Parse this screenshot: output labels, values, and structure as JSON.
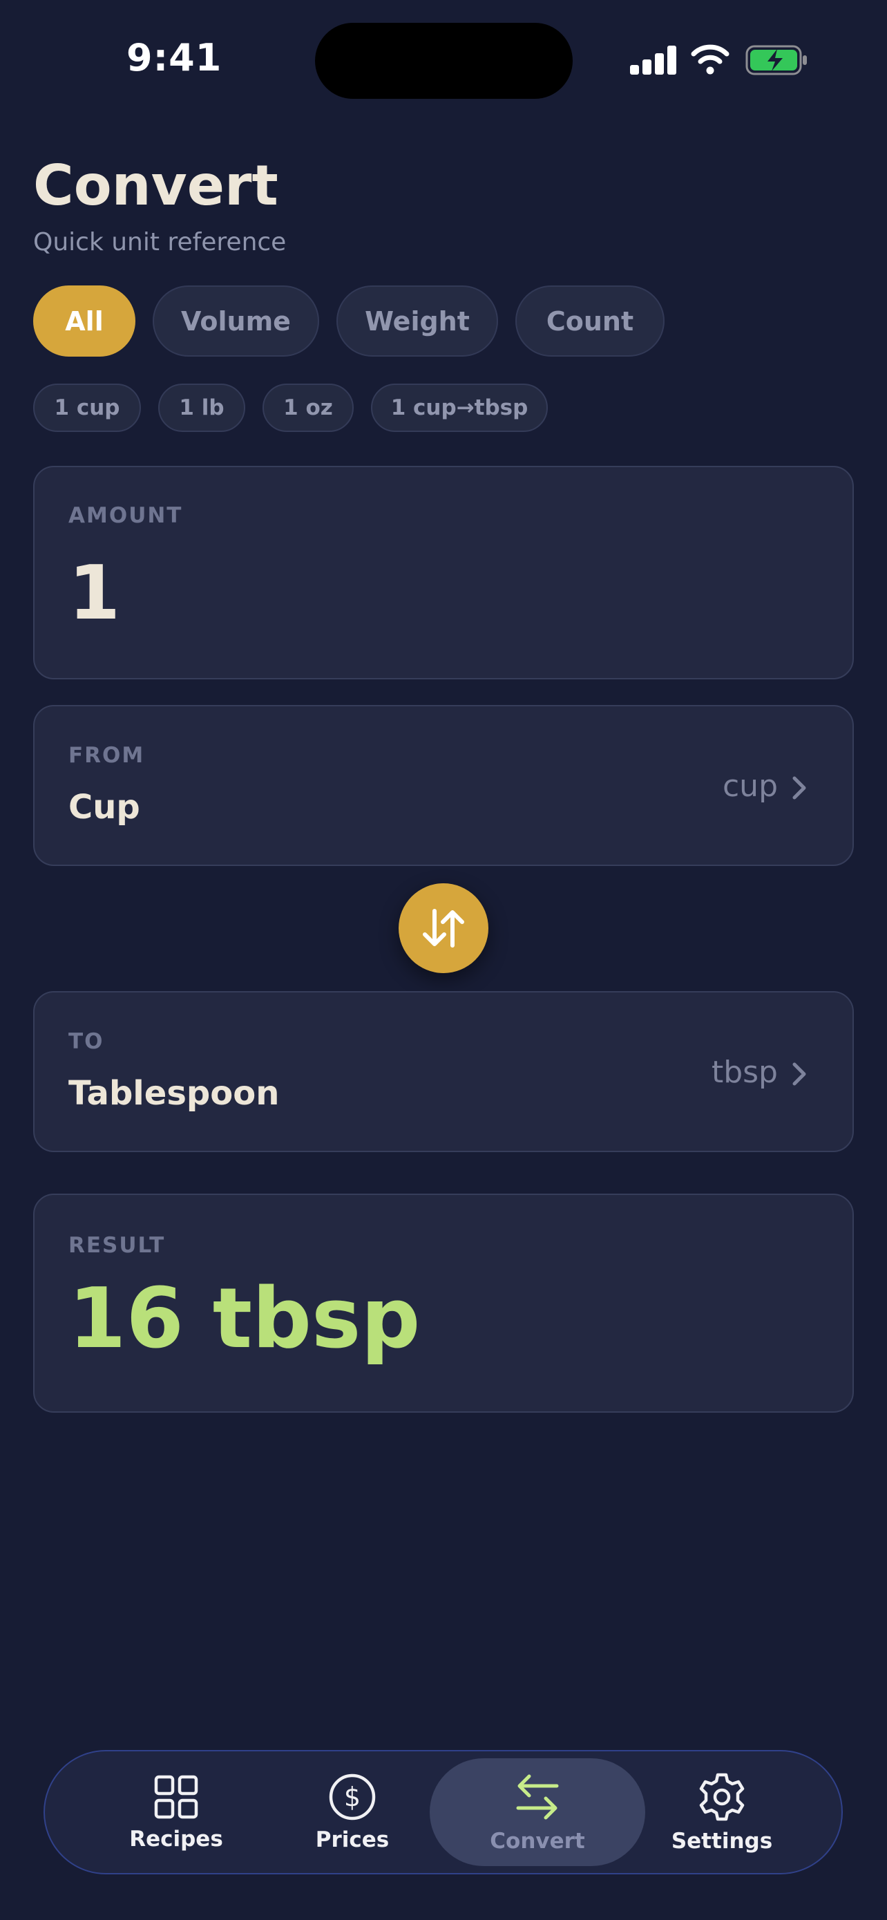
{
  "status": {
    "time": "9:41"
  },
  "header": {
    "title": "Convert",
    "subtitle": "Quick unit reference"
  },
  "filters": [
    {
      "label": "All",
      "active": true
    },
    {
      "label": "Volume",
      "active": false
    },
    {
      "label": "Weight",
      "active": false
    },
    {
      "label": "Count",
      "active": false
    }
  ],
  "quick": [
    "1 cup",
    "1 lb",
    "1 oz",
    "1 cup→tbsp"
  ],
  "amount": {
    "label": "AMOUNT",
    "value": "1"
  },
  "from": {
    "label": "FROM",
    "unit": "Cup",
    "abbr": "cup"
  },
  "to": {
    "label": "TO",
    "unit": "Tablespoon",
    "abbr": "tbsp"
  },
  "result": {
    "label": "RESULT",
    "value": "16 tbsp"
  },
  "tabs": [
    {
      "label": "Recipes",
      "icon": "grid-icon"
    },
    {
      "label": "Prices",
      "icon": "dollar-icon"
    },
    {
      "label": "Convert",
      "icon": "swap-arrows-icon",
      "active": true
    },
    {
      "label": "Settings",
      "icon": "gear-icon"
    }
  ],
  "colors": {
    "background": "#171c34",
    "accent": "#d6a63c",
    "result": "#b9e07a"
  }
}
